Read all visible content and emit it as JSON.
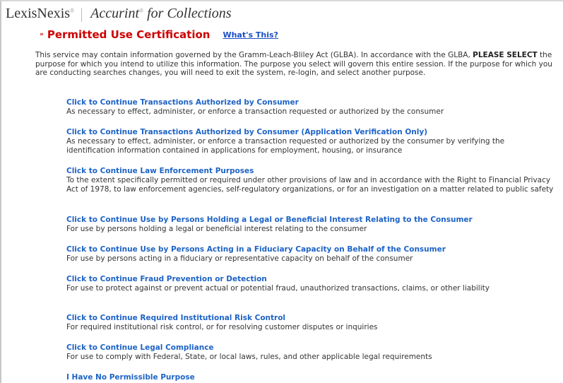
{
  "header": {
    "brand": "LexisNexis",
    "brand_mark": "®",
    "product": "Accurint",
    "product_mark": "®",
    "product_suffix": " for Collections"
  },
  "title_bar": {
    "icon": "»",
    "title": "Permitted Use Certification",
    "whats_this": "What's This?"
  },
  "intro": {
    "part1": "This service may contain information governed by the Gramm-Leach-Bliley Act (GLBA).  In accordance with the GLBA, ",
    "emphasis": "PLEASE SELECT",
    "part2": " the purpose for which you intend to utilize this information.  The purpose you select will govern this entire session.  If the purpose for which you are conducting searches changes, you will need to exit the system, re-login, and select another purpose."
  },
  "options": [
    {
      "link": "Click to Continue Transactions Authorized by Consumer",
      "desc": "As necessary to effect, administer, or enforce a transaction requested or authorized by the consumer"
    },
    {
      "link": "Click to Continue Transactions Authorized by Consumer (Application Verification Only)",
      "desc": "As necessary to effect, administer, or enforce a transaction requested or authorized by the consumer by verifying the identification information contained in applications for employment, housing, or insurance"
    },
    {
      "link": "Click to Continue Law Enforcement Purposes",
      "desc": "To the extent specifically permitted or required under other provisions of law and in accordance with the Right to Financial Privacy Act of 1978, to law enforcement agencies, self-regulatory organizations, or for an investigation on a matter related to public safety"
    },
    {
      "link": "Click to Continue Use by Persons Holding a Legal or Beneficial Interest Relating to the Consumer",
      "desc": "For use by persons holding a legal or beneficial interest relating to the consumer"
    },
    {
      "link": "Click to Continue Use by Persons Acting in a Fiduciary Capacity on Behalf of the Consumer",
      "desc": "For use by persons acting in a fiduciary or representative capacity on behalf of the consumer"
    },
    {
      "link": "Click to Continue Fraud Prevention or Detection",
      "desc": "For use to protect against or prevent actual or potential fraud, unauthorized transactions, claims, or other liability"
    },
    {
      "link": "Click to Continue Required Institutional Risk Control",
      "desc": "For required institutional risk control, or for resolving customer disputes or inquiries"
    },
    {
      "link": "Click to Continue Legal Compliance",
      "desc": "For use to comply with Federal, State, or local laws, rules, and other applicable legal requirements"
    },
    {
      "link": "I Have No Permissible Purpose",
      "desc": ""
    }
  ]
}
